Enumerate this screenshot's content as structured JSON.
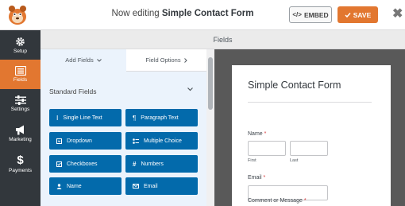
{
  "topbar": {
    "title_prefix": "Now editing",
    "title_name": "Simple Contact Form",
    "embed_label": "EMBED",
    "save_label": "SAVE",
    "close_label": "✖"
  },
  "sidebar": {
    "items": [
      {
        "label": "Setup",
        "icon": "gear-icon"
      },
      {
        "label": "Fields",
        "icon": "fields-list-icon",
        "active": true
      },
      {
        "label": "Settings",
        "icon": "sliders-icon"
      },
      {
        "label": "Marketing",
        "icon": "megaphone-icon"
      },
      {
        "label": "Payments",
        "icon": "dollar-icon"
      }
    ]
  },
  "fields_header": "Fields",
  "panel": {
    "tabs": [
      {
        "label": "Add Fields",
        "icon": "chevron-down-icon"
      },
      {
        "label": "Field Options",
        "icon": "chevron-right-icon"
      }
    ],
    "section_title": "Standard Fields",
    "buttons": [
      {
        "label": "Single Line Text",
        "icon": "text-cursor-icon"
      },
      {
        "label": "Paragraph Text",
        "icon": "paragraph-icon"
      },
      {
        "label": "Dropdown",
        "icon": "dropdown-icon"
      },
      {
        "label": "Multiple Choice",
        "icon": "radio-list-icon"
      },
      {
        "label": "Checkboxes",
        "icon": "checkbox-icon"
      },
      {
        "label": "Numbers",
        "icon": "hash-icon"
      },
      {
        "label": "Name",
        "icon": "user-icon"
      },
      {
        "label": "Email",
        "icon": "envelope-icon"
      }
    ]
  },
  "form": {
    "title": "Simple Contact Form",
    "name_label": "Name",
    "first_label": "First",
    "last_label": "Last",
    "email_label": "Email",
    "message_label": "Comment or Message",
    "required_mark": "*"
  },
  "colors": {
    "accent": "#e27730",
    "sidebar": "#32373c",
    "field_button": "#036aab",
    "panel_bg": "#ebf3fc",
    "preview_bg": "#595959"
  }
}
